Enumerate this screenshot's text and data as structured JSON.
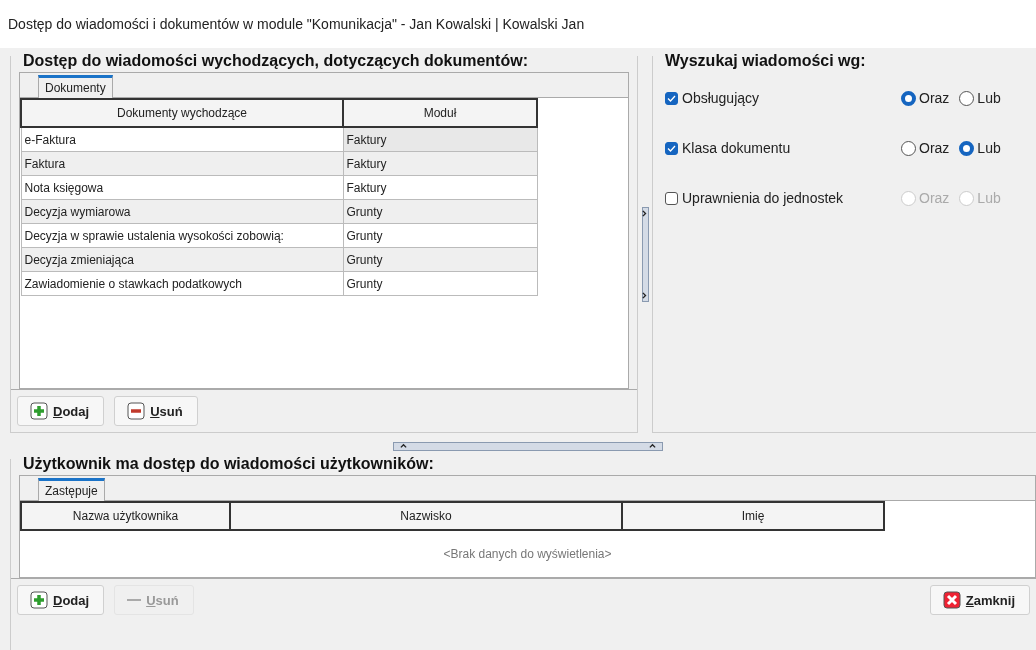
{
  "window": {
    "title": "Dostęp do wiadomości i dokumentów w module \"Komunikacja\" - Jan Kowalski | Kowalski Jan"
  },
  "documents_panel": {
    "title": "Dostęp do wiadomości wychodzących, dotyczących dokumentów:",
    "tabs": [
      {
        "label": "Dokumenty",
        "selected": true
      }
    ],
    "table": {
      "columns": [
        "Dokumenty wychodzące",
        "Moduł"
      ],
      "rows": [
        {
          "cells": [
            "e-Faktura",
            "Faktury"
          ],
          "selected": true
        },
        {
          "cells": [
            "Faktura",
            "Faktury"
          ],
          "selected": false
        },
        {
          "cells": [
            "Nota księgowa",
            "Faktury"
          ],
          "selected": false
        },
        {
          "cells": [
            "Decyzja wymiarowa",
            "Grunty"
          ],
          "selected": false
        },
        {
          "cells": [
            "Decyzja w sprawie ustalenia wysokości zobowią:",
            "Grunty"
          ],
          "selected": false
        },
        {
          "cells": [
            "Decyzja zmieniająca",
            "Grunty"
          ],
          "selected": false
        },
        {
          "cells": [
            "Zawiadomienie o stawkach podatkowych",
            "Grunty"
          ],
          "selected": false
        }
      ]
    },
    "buttons": [
      {
        "label": "Dodaj",
        "kind": "add",
        "disabled": false
      },
      {
        "label": "Usuń",
        "kind": "remove",
        "disabled": false
      }
    ]
  },
  "search_panel": {
    "title": "Wyszukaj wiadomości wg:",
    "filters": [
      {
        "label": "Obsługujący",
        "checked": true,
        "options": [
          {
            "label": "Oraz",
            "selected": true,
            "disabled": false
          },
          {
            "label": "Lub",
            "selected": false,
            "disabled": false
          }
        ]
      },
      {
        "label": "Klasa dokumentu",
        "checked": true,
        "options": [
          {
            "label": "Oraz",
            "selected": false,
            "disabled": false
          },
          {
            "label": "Lub",
            "selected": true,
            "disabled": false
          }
        ]
      },
      {
        "label": "Uprawnienia do jednostek",
        "checked": false,
        "options": [
          {
            "label": "Oraz",
            "selected": false,
            "disabled": true
          },
          {
            "label": "Lub",
            "selected": false,
            "disabled": true
          }
        ]
      }
    ]
  },
  "users_panel": {
    "title": "Użytkownik ma dostęp do wiadomości użytkowników:",
    "tabs": [
      {
        "label": "Zastępuje",
        "selected": true
      }
    ],
    "table": {
      "columns": [
        "Nazwa użytkownika",
        "Nazwisko",
        "Imię"
      ],
      "empty_text": "<Brak danych do wyświetlenia>"
    },
    "buttons": [
      {
        "label": "Dodaj",
        "kind": "add",
        "disabled": false
      },
      {
        "label": "Usuń",
        "kind": "remove",
        "disabled": true
      }
    ],
    "close_button": {
      "label": "Zamknij",
      "kind": "close",
      "disabled": false
    }
  }
}
